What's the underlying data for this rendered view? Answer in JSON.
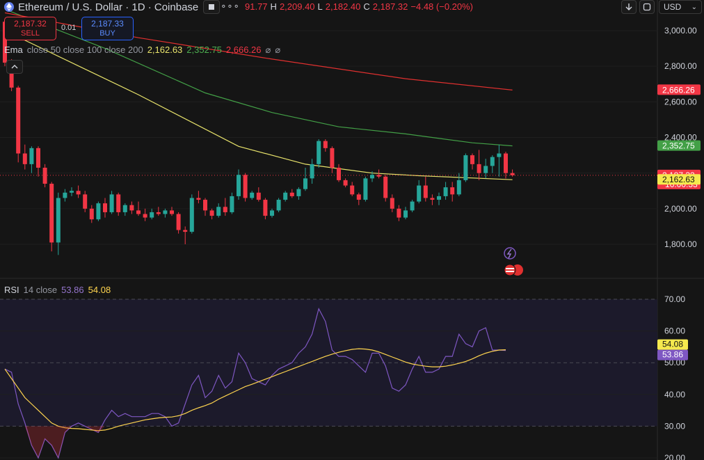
{
  "header": {
    "title": "Ethereum / U.S. Dollar · 1D · Coinbase",
    "more_label": "∘∘∘",
    "ohlc": {
      "o_value": "91.77",
      "h_label": "H",
      "h_value": "2,209.40",
      "l_label": "L",
      "l_value": "2,182.40",
      "c_label": "C",
      "c_value": "2,187.32",
      "change": "−4.48 (−0.20%)"
    },
    "currency": "USD"
  },
  "trade": {
    "sell_price": "2,187.32",
    "sell_label": "SELL",
    "spread": "0.01",
    "buy_price": "2,187.33",
    "buy_label": "BUY"
  },
  "ema_legend": {
    "name": "Ema",
    "params": "close 50 close 100 close 200",
    "v50": "2,162.63",
    "v100": "2,352.75",
    "v200": "2,666.26"
  },
  "rsi_legend": {
    "name": "RSI",
    "params": "14 close",
    "rsi": "53.86",
    "ma": "54.08"
  },
  "colors": {
    "up": "#26a69a",
    "down": "#f23645",
    "ema50": "#e8e36b",
    "ema100": "#43a047",
    "ema200": "#e0302f",
    "rsi": "#7e57c2",
    "rsi_ma": "#ffd54f"
  },
  "chart_data": [
    {
      "type": "candlestick",
      "title": "Ethereum / U.S. Dollar · 1D · Coinbase",
      "ylim": [
        1720,
        3080
      ],
      "yticks": [
        "3,000.00",
        "2,800.00",
        "2,600.00",
        "2,400.00",
        "2,200.00",
        "2,000.00",
        "1,800.00"
      ],
      "ytick_values": [
        3000,
        2800,
        2600,
        2400,
        2200,
        2000,
        1800
      ],
      "price_labels": [
        {
          "value": 2666.26,
          "text": "2,666.26",
          "color": "#f23645"
        },
        {
          "value": 2352.75,
          "text": "2,352.75",
          "color": "#43a047"
        },
        {
          "value": 2187.32,
          "text": "2,187.32",
          "sub": "16:00:33",
          "color": "#f23645"
        },
        {
          "value": 2162.63,
          "text": "2,162.63",
          "color": "#f5e94e",
          "dark": true
        }
      ],
      "candles": [
        [
          3050,
          3060,
          2800,
          2820
        ],
        [
          2820,
          2840,
          2660,
          2680
        ],
        [
          2680,
          2690,
          2260,
          2310
        ],
        [
          2310,
          2360,
          2220,
          2250
        ],
        [
          2250,
          2350,
          2200,
          2340
        ],
        [
          2340,
          2350,
          2180,
          2230
        ],
        [
          2230,
          2250,
          2120,
          2140
        ],
        [
          2140,
          2150,
          1760,
          1810
        ],
        [
          1810,
          2090,
          1740,
          2060
        ],
        [
          2060,
          2110,
          2040,
          2090
        ],
        [
          2090,
          2120,
          2070,
          2100
        ],
        [
          2100,
          2130,
          2060,
          2080
        ],
        [
          2080,
          2100,
          1980,
          2000
        ],
        [
          2000,
          2020,
          1920,
          1940
        ],
        [
          1940,
          2040,
          1930,
          2030
        ],
        [
          2030,
          2060,
          1950,
          1980
        ],
        [
          1980,
          2100,
          1970,
          2080
        ],
        [
          2080,
          2090,
          1960,
          1980
        ],
        [
          1980,
          2030,
          1960,
          2020
        ],
        [
          2020,
          2040,
          1970,
          1990
        ],
        [
          1990,
          2040,
          1960,
          1970
        ],
        [
          1970,
          2000,
          1930,
          1950
        ],
        [
          1950,
          2000,
          1940,
          1980
        ],
        [
          1980,
          2010,
          1960,
          1970
        ],
        [
          1970,
          2000,
          1950,
          1990
        ],
        [
          1990,
          2010,
          1960,
          1970
        ],
        [
          1970,
          1980,
          1860,
          1880
        ],
        [
          1880,
          1900,
          1800,
          1870
        ],
        [
          1870,
          2080,
          1860,
          2060
        ],
        [
          2060,
          2100,
          2030,
          2050
        ],
        [
          2050,
          2060,
          1960,
          1990
        ],
        [
          1990,
          2000,
          1940,
          1960
        ],
        [
          1960,
          2030,
          1950,
          2010
        ],
        [
          2010,
          2060,
          1960,
          1980
        ],
        [
          1980,
          2090,
          1970,
          2070
        ],
        [
          2070,
          2220,
          2050,
          2190
        ],
        [
          2190,
          2200,
          2040,
          2060
        ],
        [
          2060,
          2100,
          2050,
          2090
        ],
        [
          2090,
          2120,
          2040,
          2050
        ],
        [
          2050,
          2060,
          1940,
          1960
        ],
        [
          1960,
          2000,
          1950,
          1990
        ],
        [
          1990,
          2060,
          1980,
          2050
        ],
        [
          2050,
          2100,
          2040,
          2090
        ],
        [
          2090,
          2110,
          2060,
          2070
        ],
        [
          2070,
          2120,
          2050,
          2110
        ],
        [
          2110,
          2230,
          2100,
          2170
        ],
        [
          2170,
          2280,
          2140,
          2250
        ],
        [
          2250,
          2390,
          2230,
          2380
        ],
        [
          2380,
          2390,
          2320,
          2340
        ],
        [
          2340,
          2350,
          2200,
          2230
        ],
        [
          2230,
          2250,
          2150,
          2160
        ],
        [
          2160,
          2170,
          2120,
          2130
        ],
        [
          2130,
          2150,
          2070,
          2080
        ],
        [
          2080,
          2090,
          2020,
          2050
        ],
        [
          2050,
          2180,
          2040,
          2170
        ],
        [
          2170,
          2210,
          2150,
          2190
        ],
        [
          2190,
          2220,
          2170,
          2180
        ],
        [
          2180,
          2190,
          2040,
          2060
        ],
        [
          2060,
          2080,
          1980,
          2000
        ],
        [
          2000,
          2020,
          1930,
          1950
        ],
        [
          1950,
          2010,
          1940,
          1990
        ],
        [
          1990,
          2050,
          1980,
          2040
        ],
        [
          2040,
          2160,
          2030,
          2130
        ],
        [
          2130,
          2180,
          2040,
          2060
        ],
        [
          2060,
          2080,
          2020,
          2050
        ],
        [
          2050,
          2090,
          2020,
          2070
        ],
        [
          2070,
          2150,
          2050,
          2120
        ],
        [
          2120,
          2150,
          2040,
          2080
        ],
        [
          2080,
          2200,
          2070,
          2160
        ],
        [
          2160,
          2310,
          2150,
          2300
        ],
        [
          2300,
          2310,
          2220,
          2250
        ],
        [
          2250,
          2330,
          2160,
          2200
        ],
        [
          2200,
          2280,
          2170,
          2240
        ],
        [
          2240,
          2300,
          2200,
          2290
        ],
        [
          2290,
          2360,
          2180,
          2310
        ],
        [
          2310,
          2320,
          2170,
          2200
        ],
        [
          2200,
          2220,
          2180,
          2187.32
        ]
      ],
      "ema_series": [
        {
          "name": "close 50",
          "color": "#e8e36b",
          "points": [
            [
              0,
              3000
            ],
            [
              20,
              2640
            ],
            [
              35,
              2350
            ],
            [
              45,
              2250
            ],
            [
              55,
              2200
            ],
            [
              62,
              2185
            ],
            [
              76,
              2162.63
            ]
          ]
        },
        {
          "name": "close 100",
          "color": "#43a047",
          "points": [
            [
              0,
              3120
            ],
            [
              15,
              2900
            ],
            [
              30,
              2650
            ],
            [
              40,
              2540
            ],
            [
              50,
              2460
            ],
            [
              60,
              2420
            ],
            [
              70,
              2370
            ],
            [
              76,
              2352.75
            ]
          ]
        },
        {
          "name": "close 200",
          "color": "#e0302f",
          "points": [
            [
              0,
              3100
            ],
            [
              20,
              2960
            ],
            [
              40,
              2840
            ],
            [
              60,
              2730
            ],
            [
              76,
              2666.26
            ]
          ]
        }
      ]
    },
    {
      "type": "line",
      "title": "RSI 14 close",
      "ylim": [
        20,
        70
      ],
      "yticks": [
        "70.00",
        "60.00",
        "50.00",
        "40.00",
        "30.00",
        "20.00"
      ],
      "ytick_values": [
        70,
        60,
        50,
        40,
        30,
        20
      ],
      "bands": [
        30,
        70
      ],
      "rsi_labels": [
        {
          "value": 54.08,
          "text": "54.08",
          "color": "#f5e94e",
          "dark": true
        },
        {
          "value": 53.86,
          "text": "53.86",
          "color": "#7e57c2"
        }
      ],
      "rsi": [
        48,
        47,
        37,
        31,
        24,
        20,
        26,
        24,
        20,
        28,
        30,
        31,
        30,
        29,
        28,
        32,
        35,
        33,
        34,
        33,
        33,
        33,
        34,
        34,
        33,
        30,
        31,
        37,
        43,
        46,
        39,
        41,
        46,
        42,
        44,
        53,
        50,
        45,
        44,
        43,
        46,
        48,
        49,
        50,
        53,
        55,
        59,
        67,
        63,
        54,
        52,
        52,
        51,
        49,
        47,
        53,
        53,
        49,
        42,
        41,
        43,
        48,
        52,
        47,
        47,
        48,
        52,
        52,
        59,
        56,
        55,
        60,
        61,
        54,
        54,
        53.86
      ],
      "rsi_ma": [
        48,
        45,
        42,
        39,
        37,
        35,
        33,
        31,
        30,
        29.5,
        29.3,
        29.2,
        29,
        28.8,
        28.6,
        28.8,
        29.3,
        30,
        30.5,
        31,
        31.5,
        32,
        32.3,
        32.6,
        32.8,
        32.9,
        33.3,
        34,
        35,
        35.8,
        36.5,
        37.3,
        38.5,
        39.5,
        40.5,
        41.5,
        42.5,
        43.2,
        44,
        44.8,
        45.6,
        46.4,
        47.2,
        48,
        48.8,
        49.6,
        50.4,
        51.2,
        52,
        52.7,
        53.3,
        53.8,
        54.2,
        54.4,
        54.3,
        54,
        53.4,
        52.6,
        51.8,
        51,
        50.2,
        49.6,
        49.2,
        48.9,
        48.7,
        48.7,
        48.9,
        49.3,
        49.8,
        50.4,
        51.2,
        52.2,
        53,
        53.6,
        54,
        54.08
      ]
    }
  ]
}
